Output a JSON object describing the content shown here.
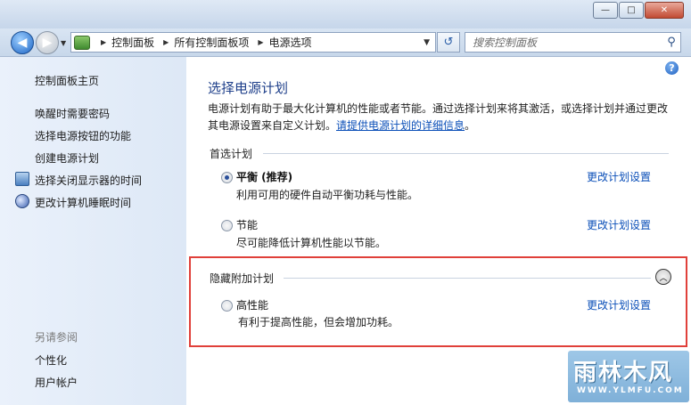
{
  "window": {
    "buttons": {
      "minimize": "—",
      "maximize": "□",
      "close": "✕"
    }
  },
  "navbar": {
    "breadcrumb": [
      "控制面板",
      "所有控制面板项",
      "电源选项"
    ],
    "search_placeholder": "搜索控制面板",
    "back_glyph": "◀",
    "forward_glyph": "▶"
  },
  "sidebar": {
    "home": "控制面板主页",
    "links": [
      {
        "label": "唤醒时需要密码",
        "icon": ""
      },
      {
        "label": "选择电源按钮的功能",
        "icon": ""
      },
      {
        "label": "创建电源计划",
        "icon": ""
      },
      {
        "label": "选择关闭显示器的时间",
        "icon": "monitor-icon"
      },
      {
        "label": "更改计算机睡眠时间",
        "icon": "moon-icon"
      }
    ],
    "see_also": "另请参阅",
    "see_also_links": [
      "个性化",
      "用户帐户"
    ]
  },
  "main": {
    "title": "选择电源计划",
    "desc": "电源计划有助于最大化计算机的性能或者节能。通过选择计划来将其激活，或选择计划并通过更改其电源设置来自定义计划。",
    "desc_link": "请提供电源计划的详细信息",
    "desc_end": "。",
    "preferred_label": "首选计划",
    "hidden_label": "隐藏附加计划",
    "change_label": "更改计划设置",
    "plans": [
      {
        "name": "平衡 (推荐)",
        "desc": "利用可用的硬件自动平衡功耗与性能。",
        "selected": true
      },
      {
        "name": "节能",
        "desc": "尽可能降低计算机性能以节能。",
        "selected": false
      },
      {
        "name": "高性能",
        "desc": "有利于提高性能，但会增加功耗。",
        "selected": false
      }
    ]
  },
  "watermark": {
    "text": "雨林木风",
    "url": "WWW.YLMFU.COM"
  },
  "colors": {
    "highlight_border": "#e0403a",
    "link": "#0b4fb8",
    "title": "#1e3f8a"
  }
}
